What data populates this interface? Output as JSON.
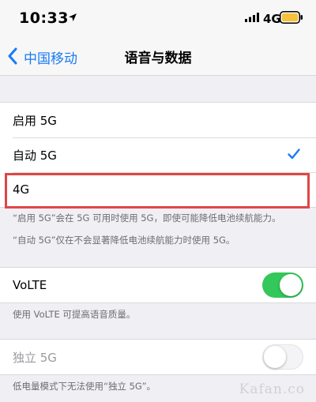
{
  "status_bar": {
    "time": "10:33",
    "network": "4G",
    "icons": [
      "location-arrow-icon",
      "cellular-signal-icon",
      "battery-icon"
    ],
    "battery_color": "#f6c23a"
  },
  "nav": {
    "back_label": "中国移动",
    "title": "语音与数据",
    "accent_color": "#1a7bf5"
  },
  "voice_data_options": [
    {
      "label": "启用 5G",
      "selected": false
    },
    {
      "label": "自动 5G",
      "selected": true
    },
    {
      "label": "4G",
      "selected": false,
      "highlighted": true
    }
  ],
  "option_footnotes": [
    "“启用 5G”会在 5G 可用时使用 5G，即使可能降低电池续航能力。",
    "“自动 5G”仅在不会显著降低电池续航能力时使用 5G。"
  ],
  "volte": {
    "label": "VoLTE",
    "enabled": true,
    "footnote": "使用 VoLTE 可提高语音质量。",
    "toggle_color": "#34c759"
  },
  "standalone_5g": {
    "label": "独立 5G",
    "enabled": false,
    "disabled": true,
    "footnote": "低电量模式下无法使用“独立 5G”。"
  },
  "highlight_color": "#e04646",
  "watermark": "Kafan.co"
}
